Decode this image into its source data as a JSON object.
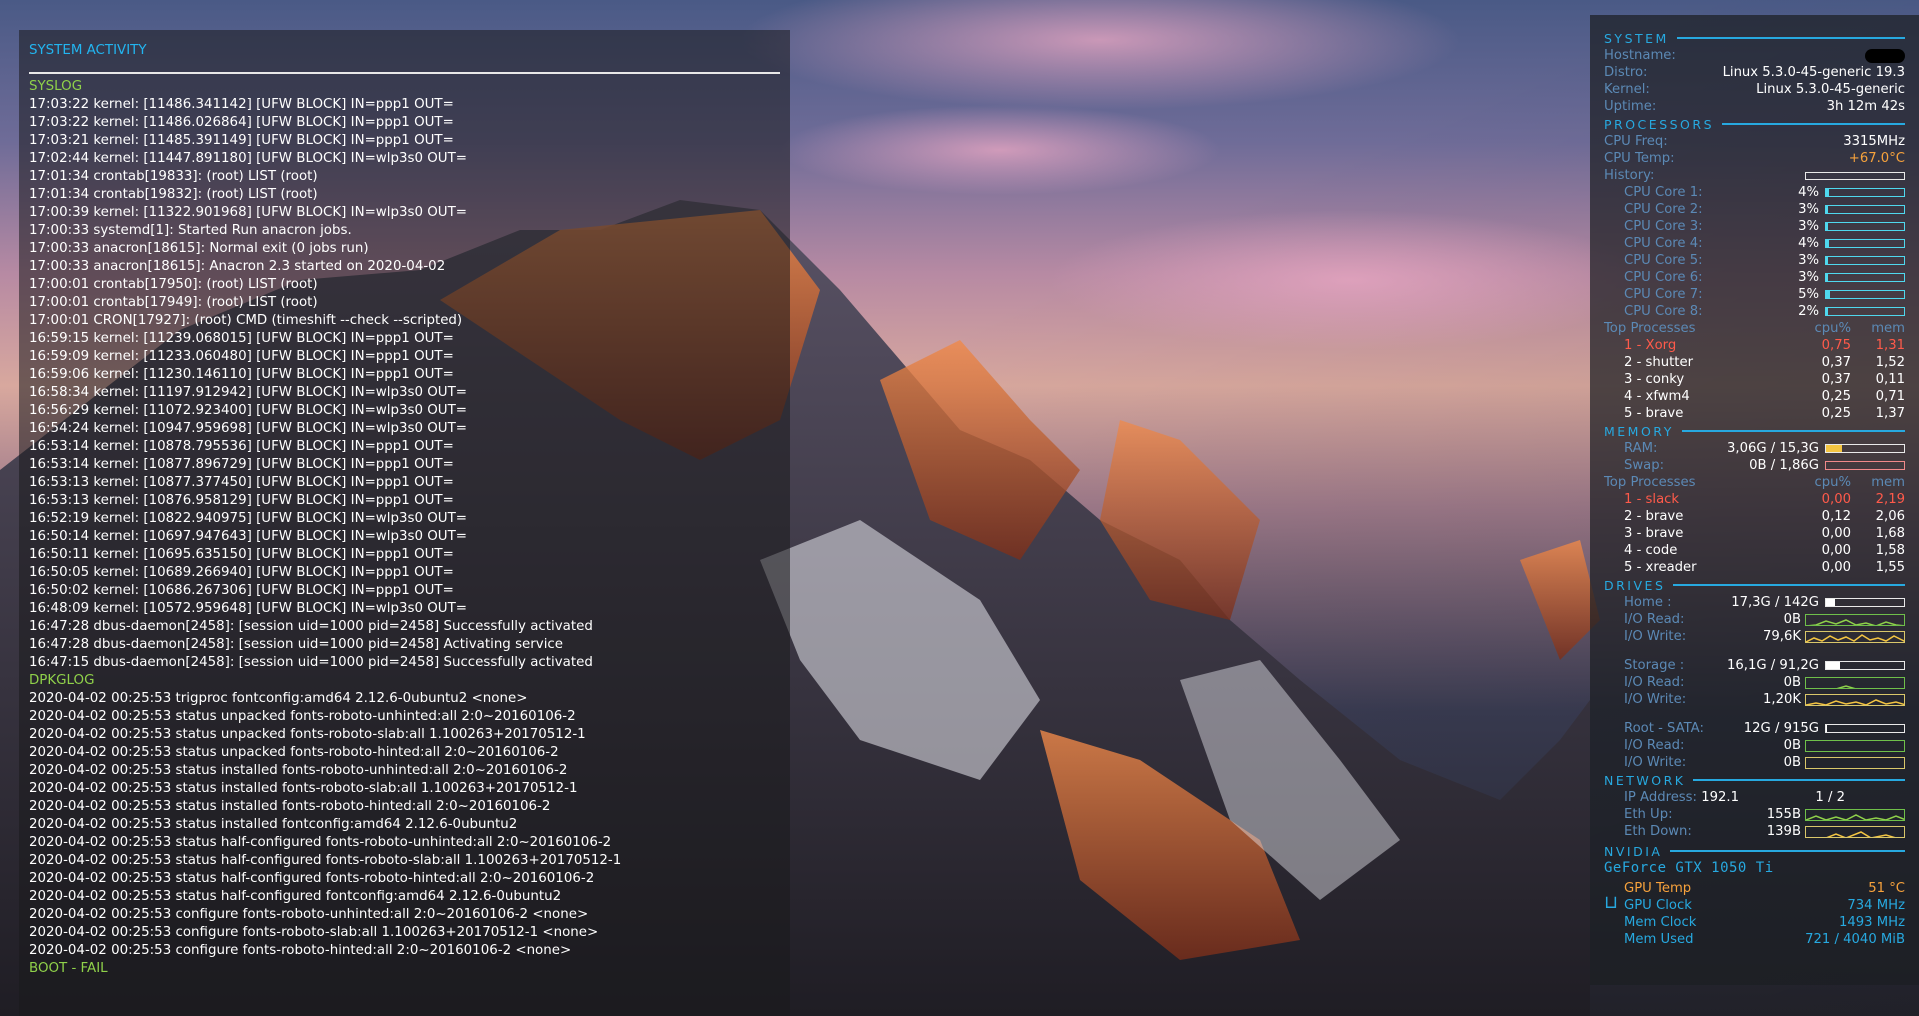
{
  "system_activity": {
    "title": "SYSTEM ACTIVITY",
    "syslog_header": "SYSLOG",
    "syslog": [
      "17:03:22 kernel: [11486.341142] [UFW BLOCK] IN=ppp1 OUT=",
      "17:03:22 kernel: [11486.026864] [UFW BLOCK] IN=ppp1 OUT=",
      "17:03:21 kernel: [11485.391149] [UFW BLOCK] IN=ppp1 OUT=",
      "17:02:44 kernel: [11447.891180] [UFW BLOCK] IN=wlp3s0 OUT=",
      "17:01:34 crontab[19833]: (root) LIST (root)",
      "17:01:34 crontab[19832]: (root) LIST (root)",
      "17:00:39 kernel: [11322.901968] [UFW BLOCK] IN=wlp3s0 OUT=",
      "17:00:33 systemd[1]: Started Run anacron jobs.",
      "17:00:33 anacron[18615]: Normal exit (0 jobs run)",
      "17:00:33 anacron[18615]: Anacron 2.3 started on 2020-04-02",
      "17:00:01 crontab[17950]: (root) LIST (root)",
      "17:00:01 crontab[17949]: (root) LIST (root)",
      "17:00:01 CRON[17927]: (root) CMD (timeshift --check --scripted)",
      "16:59:15 kernel: [11239.068015] [UFW BLOCK] IN=ppp1 OUT=",
      "16:59:09 kernel: [11233.060480] [UFW BLOCK] IN=ppp1 OUT=",
      "16:59:06 kernel: [11230.146110] [UFW BLOCK] IN=ppp1 OUT=",
      "16:58:34 kernel: [11197.912942] [UFW BLOCK] IN=wlp3s0 OUT=",
      "16:56:29 kernel: [11072.923400] [UFW BLOCK] IN=wlp3s0 OUT=",
      "16:54:24 kernel: [10947.959698] [UFW BLOCK] IN=wlp3s0 OUT=",
      "16:53:14 kernel: [10878.795536] [UFW BLOCK] IN=ppp1 OUT=",
      "16:53:14 kernel: [10877.896729] [UFW BLOCK] IN=ppp1 OUT=",
      "16:53:13 kernel: [10877.377450] [UFW BLOCK] IN=ppp1 OUT=",
      "16:53:13 kernel: [10876.958129] [UFW BLOCK] IN=ppp1 OUT=",
      "16:52:19 kernel: [10822.940975] [UFW BLOCK] IN=wlp3s0 OUT=",
      "16:50:14 kernel: [10697.947643] [UFW BLOCK] IN=wlp3s0 OUT=",
      "16:50:11 kernel: [10695.635150] [UFW BLOCK] IN=ppp1 OUT=",
      "16:50:05 kernel: [10689.266940] [UFW BLOCK] IN=ppp1 OUT=",
      "16:50:02 kernel: [10686.267306] [UFW BLOCK] IN=ppp1 OUT=",
      "16:48:09 kernel: [10572.959648] [UFW BLOCK] IN=wlp3s0 OUT=",
      "16:47:28 dbus-daemon[2458]: [session uid=1000 pid=2458] Successfully activated",
      "16:47:28 dbus-daemon[2458]: [session uid=1000 pid=2458] Activating service",
      "16:47:15 dbus-daemon[2458]: [session uid=1000 pid=2458] Successfully activated"
    ],
    "dpkglog_header": "DPKGLOG",
    "dpkglog": [
      "2020-04-02 00:25:53 trigproc fontconfig:amd64 2.12.6-0ubuntu2 <none>",
      "2020-04-02 00:25:53 status unpacked fonts-roboto-unhinted:all 2:0~20160106-2",
      "2020-04-02 00:25:53 status unpacked fonts-roboto-slab:all 1.100263+20170512-1",
      "2020-04-02 00:25:53 status unpacked fonts-roboto-hinted:all 2:0~20160106-2",
      "2020-04-02 00:25:53 status installed fonts-roboto-unhinted:all 2:0~20160106-2",
      "2020-04-02 00:25:53 status installed fonts-roboto-slab:all 1.100263+20170512-1",
      "2020-04-02 00:25:53 status installed fonts-roboto-hinted:all 2:0~20160106-2",
      "2020-04-02 00:25:53 status installed fontconfig:amd64 2.12.6-0ubuntu2",
      "2020-04-02 00:25:53 status half-configured fonts-roboto-unhinted:all 2:0~20160106-2",
      "2020-04-02 00:25:53 status half-configured fonts-roboto-slab:all 1.100263+20170512-1",
      "2020-04-02 00:25:53 status half-configured fonts-roboto-hinted:all 2:0~20160106-2",
      "2020-04-02 00:25:53 status half-configured fontconfig:amd64 2.12.6-0ubuntu2",
      "2020-04-02 00:25:53 configure fonts-roboto-unhinted:all 2:0~20160106-2 <none>",
      "2020-04-02 00:25:53 configure fonts-roboto-slab:all 1.100263+20170512-1 <none>",
      "2020-04-02 00:25:53 configure fonts-roboto-hinted:all 2:0~20160106-2 <none>"
    ],
    "boot_header": "BOOT - FAIL"
  },
  "conky": {
    "system": {
      "header": "SYSTEM",
      "hostname_label": "Hostname:",
      "distro_label": "Distro:",
      "distro": "Linux 5.3.0-45-generic 19.3",
      "kernel_label": "Kernel:",
      "kernel": "Linux 5.3.0-45-generic",
      "uptime_label": "Uptime:",
      "uptime": "3h 12m 42s"
    },
    "processors": {
      "header": "PROCESSORS",
      "freq_label": "CPU Freq:",
      "freq": "3315MHz",
      "temp_label": "CPU Temp:",
      "temp": "+67.0°C",
      "history_label": "History:",
      "cores": [
        {
          "label": "CPU Core 1:",
          "pct": "4%",
          "value": 4
        },
        {
          "label": "CPU Core 2:",
          "pct": "3%",
          "value": 3
        },
        {
          "label": "CPU Core 3:",
          "pct": "3%",
          "value": 3
        },
        {
          "label": "CPU Core 4:",
          "pct": "4%",
          "value": 4
        },
        {
          "label": "CPU Core 5:",
          "pct": "3%",
          "value": 3
        },
        {
          "label": "CPU Core 6:",
          "pct": "3%",
          "value": 3
        },
        {
          "label": "CPU Core 7:",
          "pct": "5%",
          "value": 5
        },
        {
          "label": "CPU Core 8:",
          "pct": "2%",
          "value": 2
        }
      ],
      "top_label": "Top Processes",
      "col_cpu": "cpu%",
      "col_mem": "mem",
      "top": [
        {
          "name": "1  -  Xorg",
          "cpu": "0,75",
          "mem": "1,31"
        },
        {
          "name": "2  -  shutter",
          "cpu": "0,37",
          "mem": "1,52"
        },
        {
          "name": "3  -  conky",
          "cpu": "0,37",
          "mem": "0,11"
        },
        {
          "name": "4  -  xfwm4",
          "cpu": "0,25",
          "mem": "0,71"
        },
        {
          "name": "5  -  brave",
          "cpu": "0,25",
          "mem": "1,37"
        }
      ]
    },
    "memory": {
      "header": "MEMORY",
      "ram_label": "RAM:",
      "ram": "3,06G / 15,3G",
      "ram_fraction": 0.2,
      "swap_label": "Swap:",
      "swap": "0B / 1,86G",
      "swap_fraction": 0,
      "top_label": "Top Processes",
      "col_cpu": "cpu%",
      "col_mem": "mem",
      "top": [
        {
          "name": "1  -  slack",
          "cpu": "0,00",
          "mem": "2,19"
        },
        {
          "name": "2  -  brave",
          "cpu": "0,12",
          "mem": "2,06"
        },
        {
          "name": "3  -  brave",
          "cpu": "0,00",
          "mem": "1,68"
        },
        {
          "name": "4  -  code",
          "cpu": "0,00",
          "mem": "1,58"
        },
        {
          "name": "5  -  xreader",
          "cpu": "0,00",
          "mem": "1,55"
        }
      ]
    },
    "drives": {
      "header": "DRIVES",
      "home_label": "Home :",
      "home": "17,3G / 142G",
      "home_fraction": 0.12,
      "home_read_label": "I/O Read:",
      "home_read": "0B",
      "home_write_label": "I/O Write:",
      "home_write": "79,6K",
      "storage_label": "Storage :",
      "storage": "16,1G / 91,2G",
      "storage_fraction": 0.18,
      "storage_read_label": "I/O Read:",
      "storage_read": "0B",
      "storage_write_label": "I/O Write:",
      "storage_write": "1,20K",
      "root_label": "Root  -  SATA:",
      "root": "12G / 915G",
      "root_fraction": 0.013,
      "root_read_label": "I/O Read:",
      "root_read": "0B",
      "root_write_label": "I/O Write:",
      "root_write": "0B"
    },
    "network": {
      "header": "NETWORK",
      "ip_label": "IP Address:",
      "ip_a": "192.1",
      "ip_b": "1 / 2",
      "up_label": "Eth Up:",
      "up": "155B",
      "down_label": "Eth Down:",
      "down": "139B"
    },
    "nvidia": {
      "header": "NVIDIA",
      "card": "GeForce GTX 1050 Ti",
      "temp_label": "GPU Temp",
      "temp": "51 °C",
      "clock_label": "GPU Clock",
      "clock": "734 MHz",
      "mem_clock_label": "Mem Clock",
      "mem_clock": "1493 MHz",
      "mem_used_label": "Mem Used",
      "mem_used": "721 / 4040 MiB"
    },
    "colors": {
      "accent": "#27a9e0",
      "label": "#5b89b5",
      "warm": "#f7a23c",
      "top": "#ff5a4a",
      "ram_bar": "#f4c542",
      "swap_bar": "#f08a8a"
    }
  }
}
